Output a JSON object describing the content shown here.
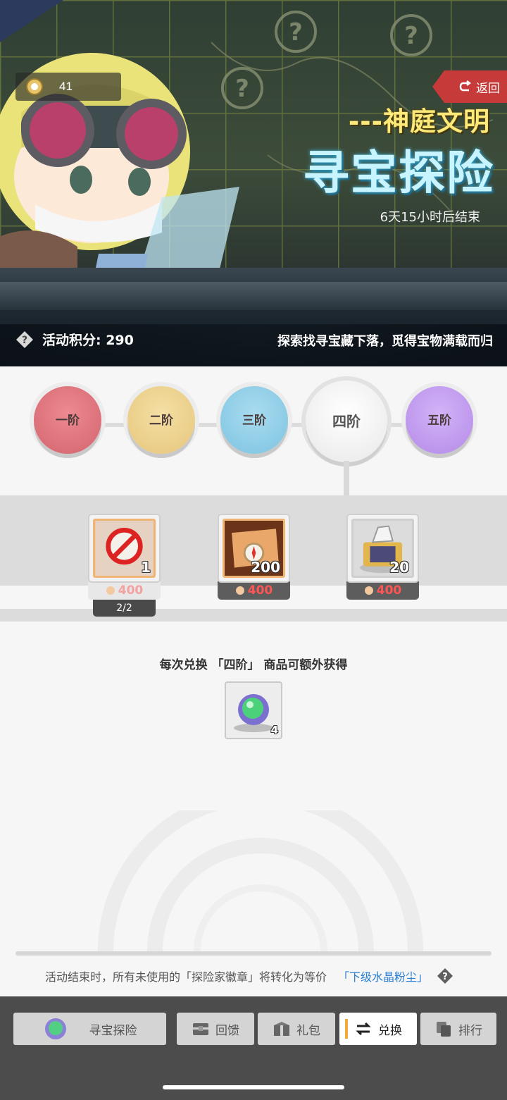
{
  "header": {
    "score_value": "41",
    "return_label": "返回",
    "subtitle": "---神庭文明",
    "title": "寻宝探险",
    "countdown": "6天15小时后结束",
    "points_label": "活动积分: 290",
    "slogan": "探索找寻宝藏下落，觅得宝物满载而归"
  },
  "tiers": [
    {
      "label": "一阶",
      "color": "#d4646e"
    },
    {
      "label": "二阶",
      "color": "#e6c67c"
    },
    {
      "label": "三阶",
      "color": "#7ec3e0"
    },
    {
      "label": "四阶",
      "color": "#e8e8e8",
      "selected": true
    },
    {
      "label": "五阶",
      "color": "#b48ae8"
    }
  ],
  "items": [
    {
      "icon": "no-entry-item-icon",
      "quantity": "1",
      "price": "400",
      "limit": "2/2",
      "state": "sold-out"
    },
    {
      "icon": "treasure-map-compass-icon",
      "quantity": "200",
      "price": "400"
    },
    {
      "icon": "crystal-box-icon",
      "quantity": "20",
      "price": "400"
    }
  ],
  "bonus": {
    "text": "每次兑换 「四阶」 商品可额外获得",
    "icon": "green-gem-ring-icon",
    "quantity": "4"
  },
  "note": {
    "text": "活动结束时，所有未使用的「探险家徽章」将转化为等价",
    "link": "「下级水晶粉尘」"
  },
  "tabs": [
    {
      "label": "寻宝探险",
      "icon": "gem-orb-icon"
    },
    {
      "label": "回馈",
      "icon": "chest-icon"
    },
    {
      "label": "礼包",
      "icon": "gift-box-icon"
    },
    {
      "label": "兑换",
      "icon": "exchange-arrows-icon",
      "active": true
    },
    {
      "label": "排行",
      "icon": "ranking-icon"
    }
  ],
  "colors": {
    "accent_red": "#c63a3a",
    "price_red": "#f55555",
    "link_blue": "#2a7fd4",
    "active_tab_marker": "#f0a93a"
  }
}
